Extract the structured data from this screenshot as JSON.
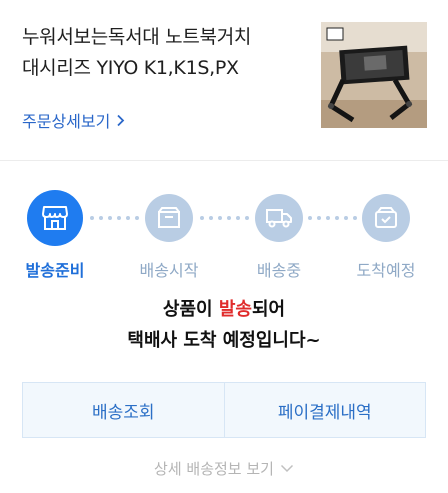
{
  "product": {
    "title_line1": "누워서보는독서대 노트북거치",
    "title_line2": "대시리즈 YIYO K1,K1S,PX",
    "detail_link": "주문상세보기",
    "image_caption": "노트북 거치대 상품 사진"
  },
  "steps": [
    {
      "label": "발송준비",
      "icon": "store-icon",
      "state": "active"
    },
    {
      "label": "배송시작",
      "icon": "box-icon",
      "state": "inactive"
    },
    {
      "label": "배송중",
      "icon": "truck-icon",
      "state": "inactive"
    },
    {
      "label": "도착예정",
      "icon": "check-box-icon",
      "state": "inactive"
    }
  ],
  "status": {
    "line1_pre": "상품이 ",
    "line1_highlight": "발송",
    "line1_post": "되어",
    "line2": "택배사 도착 예정입니다~"
  },
  "buttons": {
    "track": "배송조회",
    "payment": "페이결제내역"
  },
  "more": {
    "label": "상세 배송정보 보기"
  },
  "colors": {
    "accent": "#1f7cf0",
    "inactive": "#b9cde4",
    "highlight": "#e02b2b",
    "link": "#2a67c9"
  }
}
